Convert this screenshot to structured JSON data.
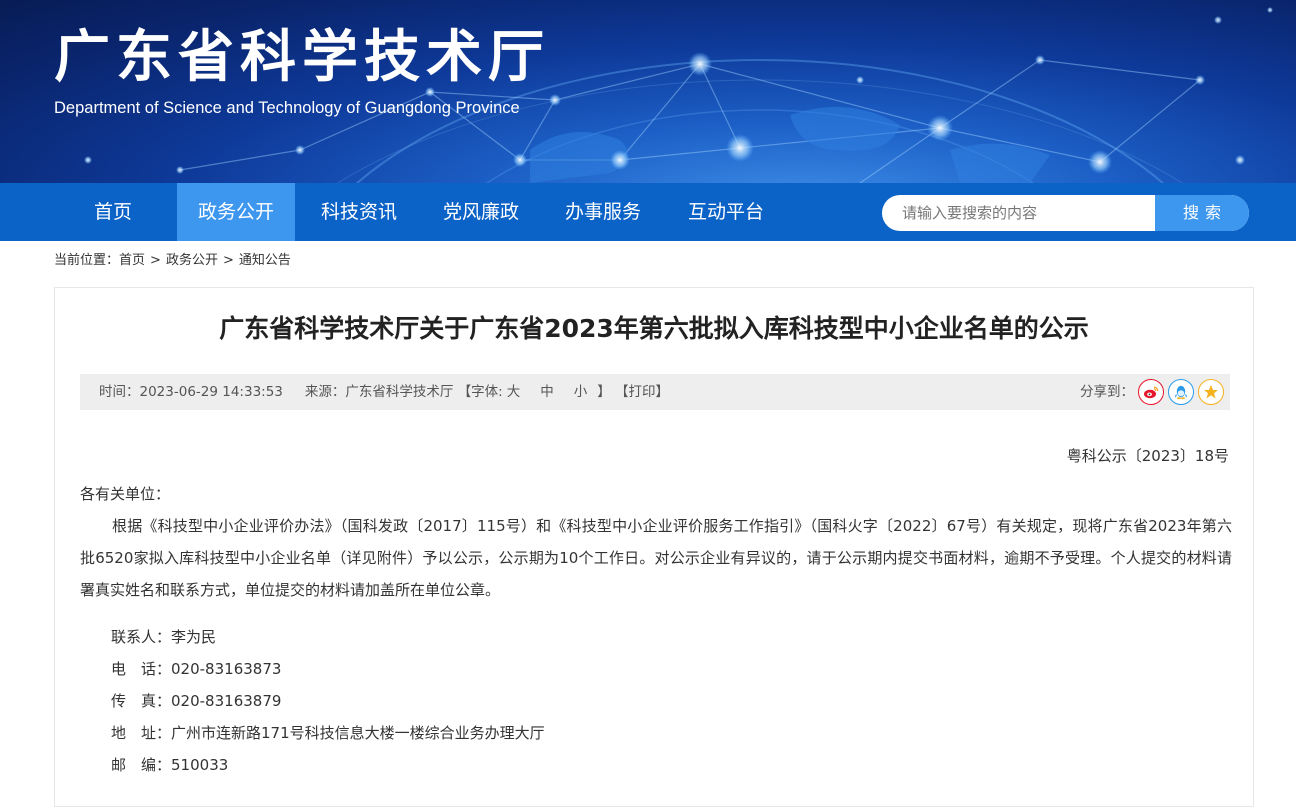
{
  "header": {
    "title": "广东省科学技术厅",
    "subtitle": "Department of Science and Technology of Guangdong Province"
  },
  "nav": {
    "items": [
      {
        "label": "首页",
        "active": false
      },
      {
        "label": "政务公开",
        "active": true
      },
      {
        "label": "科技资讯",
        "active": false
      },
      {
        "label": "党风廉政",
        "active": false
      },
      {
        "label": "办事服务",
        "active": false
      },
      {
        "label": "互动平台",
        "active": false
      }
    ],
    "search_placeholder": "请输入要搜索的内容",
    "search_button": "搜索"
  },
  "breadcrumb": {
    "prefix": "当前位置：",
    "items": [
      "首页",
      "政务公开",
      "通知公告"
    ],
    "separator": ">"
  },
  "article": {
    "title": "广东省科学技术厅关于广东省2023年第六批拟入库科技型中小企业名单的公示",
    "meta": {
      "time_label": "时间：",
      "time": "2023-06-29 14:33:53",
      "source_label": "来源：",
      "source": "广东省科学技术厅",
      "font_label": "【字体:",
      "font_sizes": [
        "大",
        "中",
        "小"
      ],
      "font_close": "】",
      "print": "【打印】",
      "share_label": "分享到：",
      "share_icons": [
        "weibo-icon",
        "qq-icon",
        "qzone-icon"
      ]
    },
    "doc_number": "粤科公示〔2023〕18号",
    "salutation": "各有关单位：",
    "paragraph": "根据《科技型中小企业评价办法》（国科发政〔2017〕115号）和《科技型中小企业评价服务工作指引》（国科火字〔2022〕67号）有关规定，现将广东省2023年第六批6520家拟入库科技型中小企业名单（详见附件）予以公示，公示期为10个工作日。对公示企业有异议的，请于公示期内提交书面材料，逾期不予受理。个人提交的材料请署真实姓名和联系方式，单位提交的材料请加盖所在单位公章。",
    "contacts": [
      {
        "label": "联系人：",
        "value": "李为民"
      },
      {
        "label": "电　话：",
        "value": "020-83163873"
      },
      {
        "label": "传　真：",
        "value": "020-83163879"
      },
      {
        "label": "地　址：",
        "value": "广州市连新路171号科技信息大楼一楼综合业务办理大厅"
      },
      {
        "label": "邮　编：",
        "value": "510033"
      }
    ]
  },
  "colors": {
    "nav_bg": "#0c63c7",
    "nav_active": "#3d97ee",
    "weibo": "#e6162d",
    "qq": "#2b9be8",
    "qzone": "#f4b120"
  }
}
